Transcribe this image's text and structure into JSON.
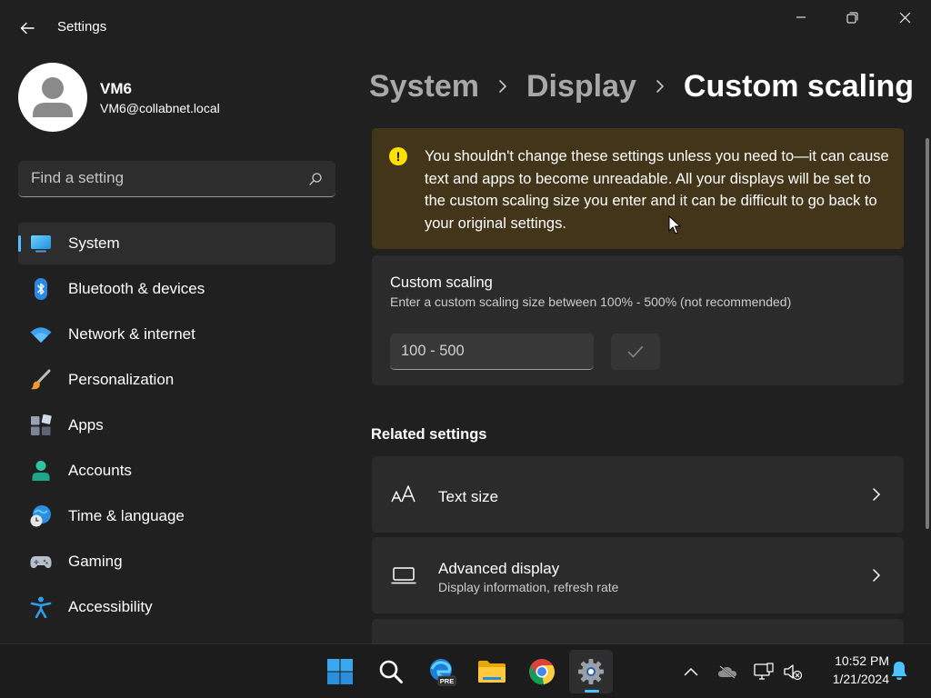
{
  "window": {
    "title": "Settings",
    "controls": {
      "minimize": "minimize",
      "maximize": "restore",
      "close": "close"
    }
  },
  "profile": {
    "name": "VM6",
    "email": "VM6@collabnet.local"
  },
  "search": {
    "placeholder": "Find a setting",
    "value": ""
  },
  "sidebar": {
    "items": [
      {
        "label": "System",
        "icon": "monitor-icon",
        "selected": true
      },
      {
        "label": "Bluetooth & devices",
        "icon": "bluetooth-icon",
        "selected": false
      },
      {
        "label": "Network & internet",
        "icon": "wifi-icon",
        "selected": false
      },
      {
        "label": "Personalization",
        "icon": "paintbrush-icon",
        "selected": false
      },
      {
        "label": "Apps",
        "icon": "apps-icon",
        "selected": false
      },
      {
        "label": "Accounts",
        "icon": "person-icon",
        "selected": false
      },
      {
        "label": "Time & language",
        "icon": "globe-clock-icon",
        "selected": false
      },
      {
        "label": "Gaming",
        "icon": "gamepad-icon",
        "selected": false
      },
      {
        "label": "Accessibility",
        "icon": "accessibility-icon",
        "selected": false
      }
    ]
  },
  "breadcrumb": [
    "System",
    "Display",
    "Custom scaling"
  ],
  "warning": {
    "text": "You shouldn't change these settings unless you need to—it can cause text and apps to become unreadable. All your displays will be set to the custom scaling size you enter and it can be difficult to go back to your original settings."
  },
  "custom_scaling": {
    "title": "Custom scaling",
    "description": "Enter a custom scaling size between 100% - 500% (not recommended)",
    "input_placeholder": "100 - 500",
    "input_value": "",
    "apply_icon": "checkmark-icon"
  },
  "related": {
    "heading": "Related settings",
    "items": [
      {
        "title": "Text size",
        "subtitle": "",
        "icon": "text-size-icon"
      },
      {
        "title": "Advanced display",
        "subtitle": "Display information, refresh rate",
        "icon": "laptop-icon"
      }
    ]
  },
  "taskbar": {
    "apps": [
      "start-icon",
      "search-icon",
      "edge-preview-icon",
      "file-explorer-icon",
      "chrome-icon",
      "settings-icon"
    ],
    "edge_badge": "PRE",
    "active_app": "settings-icon",
    "tray": [
      "chevron-up-icon",
      "onedrive-icon",
      "display-network-icon",
      "speaker-muted-icon"
    ],
    "time": "10:52 PM",
    "date": "1/21/2024",
    "notification_icon": "bell-icon"
  },
  "colors": {
    "background": "#202020",
    "card": "#2b2b2b",
    "accent": "#4cc2ff",
    "warning_bg": "#433519",
    "warning_icon": "#fce100"
  }
}
